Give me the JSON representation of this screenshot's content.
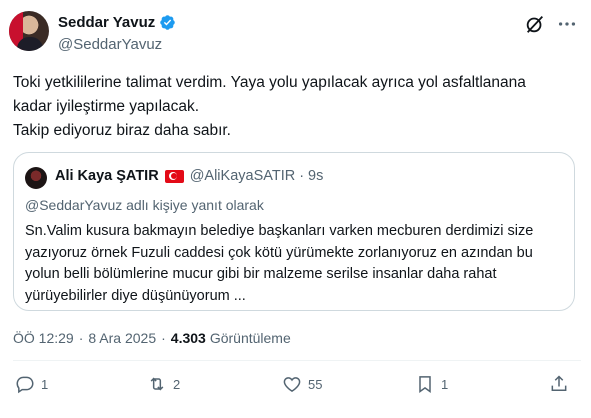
{
  "author": {
    "display_name": "Seddar Yavuz",
    "handle": "@SeddarYavuz"
  },
  "tweet": {
    "text_lines": [
      "Toki yetkililerine talimat verdim. Yaya yolu yapılacak ayrıca yol asfaltlanana",
      "kadar iyileştirme yapılacak.",
      "Takip ediyoruz biraz daha sabır."
    ]
  },
  "quote": {
    "display_name": "Ali Kaya ŞATIR",
    "handle": "@AliKayaSATIR",
    "separator": "·",
    "time": "9s",
    "reply_note": "@SeddarYavuz adlı kişiye yanıt olarak",
    "text_lines": [
      "Sn.Valim kusura bakmayın belediye başkanları varken mecburen derdimizi size",
      "yazıyoruz örnek Fuzuli caddesi çok kötü yürümekte zorlanıyoruz en azından bu",
      "yolun belli bölümlerine mucur gibi bir malzeme serilse insanlar daha rahat",
      "yürüyebilirler diye düşünüyorum ..."
    ]
  },
  "meta": {
    "time": "ÖÖ 12:29",
    "separator": "·",
    "date": "8 Ara 2025",
    "views_count": "4.303",
    "views_label": "Görüntüleme"
  },
  "actions": {
    "reply_count": "1",
    "retweet_count": "2",
    "like_count": "55",
    "bookmark_count": "1"
  },
  "icons": {
    "verified": "verified-badge-icon",
    "grok": "grok-icon",
    "more": "more-icon",
    "reply": "reply-icon",
    "retweet": "retweet-icon",
    "like": "heart-icon",
    "bookmark": "bookmark-icon",
    "share": "share-icon"
  },
  "colors": {
    "verified_blue": "#1d9bf0",
    "secondary_text": "#536471",
    "primary_text": "#0f1419",
    "border": "#cfd9de"
  }
}
